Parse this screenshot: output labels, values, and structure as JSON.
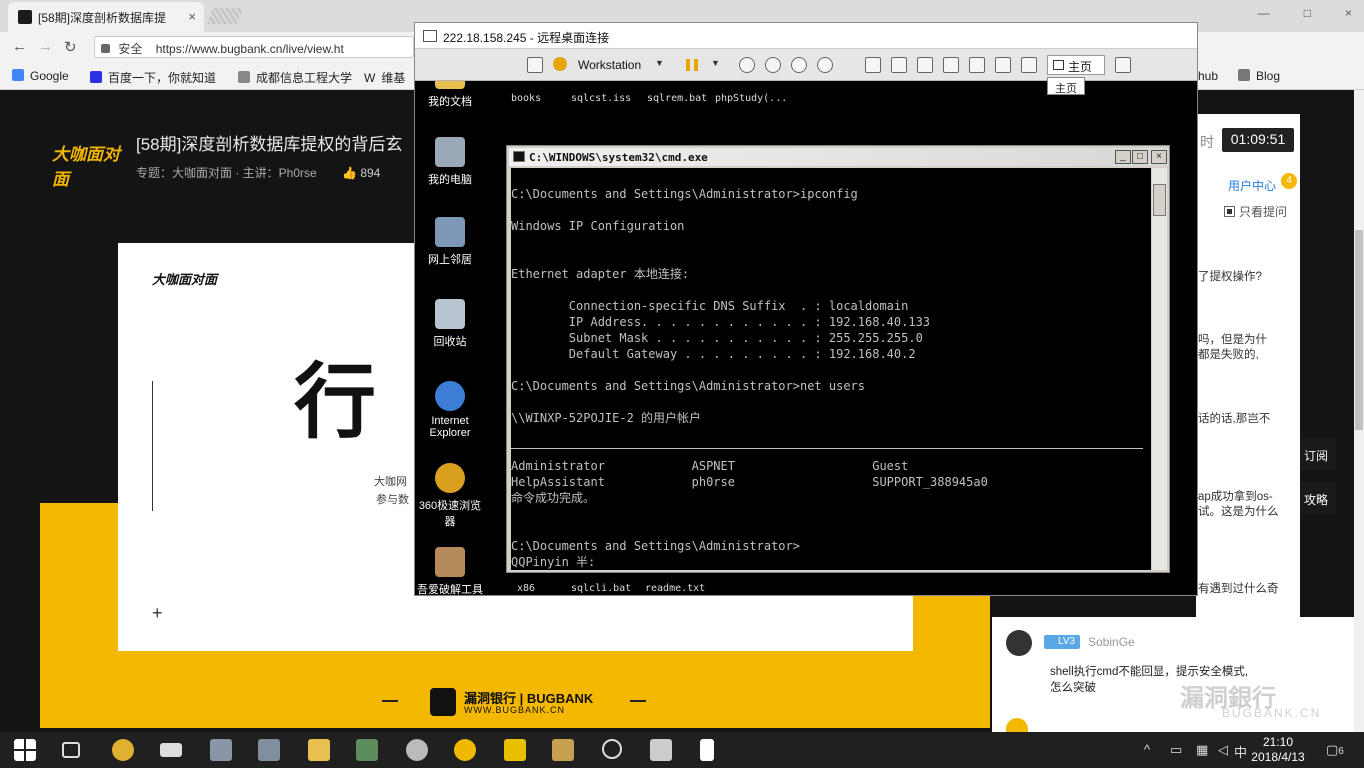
{
  "browser": {
    "tab_title": "[58期]深度剖析数据库提",
    "tab_close": "×",
    "window_controls": [
      "—",
      "□",
      "×"
    ],
    "security_label": "安全",
    "url": "https://www.bugbank.cn/live/view.ht",
    "bookmarks": [
      "Google",
      "百度一下，你就知道",
      "成都信息工程大学",
      "维基"
    ],
    "bookmark_w": "W",
    "bookmark_tail": [
      "hub",
      "Blog"
    ]
  },
  "page": {
    "course_title": "[58期]深度剖析数据库提权的背后玄",
    "course_meta": "专题：大咖面对面 · 主讲：Ph0rse",
    "likes": "894",
    "left_logo": "大咖面对面",
    "slide": {
      "logo": "大咖面对面",
      "big_char": "行",
      "sub1": "大咖网",
      "sub2": "参与数"
    },
    "footer_logo_line1": "漏洞银行 | BUGBANK",
    "footer_logo_line2": "WWW.BUGBANK.CN"
  },
  "right_panel": {
    "timer_label": "时",
    "timer": "01:09:51",
    "user_center": "用户中心",
    "user_center_badge": "4",
    "only_questions": "只看提问",
    "snippets": [
      "了提权操作?",
      "吗，但是为什",
      "都是失败的,",
      "话的话,那岂不",
      "ap成功拿到os-",
      "试。这是为什么",
      "有遇到过什么奇"
    ],
    "side_tabs": [
      "订阅",
      "攻略"
    ],
    "chat": {
      "level": "LV3",
      "user": "SobinGe",
      "msg_line1": "shell执行cmd不能回显，提示安全模式,",
      "msg_line2": "怎么突破"
    },
    "watermark": "漏洞銀行",
    "watermark_sub": "BUGBANK.CN"
  },
  "rdp": {
    "title": "222.18.158.245 - 远程桌面连接",
    "workstation": "Workstation",
    "home_label": "主页",
    "home_tooltip": "主页",
    "desktop_icons": [
      "我的文档",
      "我的电脑",
      "网上邻居",
      "回收站",
      "Internet Explorer",
      "360极速浏览器",
      "吾爱破解工具"
    ],
    "top_files": [
      "books",
      "sqlcst.iss",
      "sqlrem.bat",
      "phpStudy(..."
    ],
    "bottom_files": [
      "x86",
      "sqlcli.bat",
      "readme.txt"
    ]
  },
  "cmd": {
    "title": "C:\\WINDOWS\\system32\\cmd.exe",
    "buttons": [
      "_",
      "□",
      "×"
    ],
    "lines": [
      "C:\\Documents and Settings\\Administrator>ipconfig",
      "Windows IP Configuration",
      "Ethernet adapter 本地连接:",
      "        Connection-specific DNS Suffix  . : localdomain",
      "        IP Address. . . . . . . . . . . . : 192.168.40.133",
      "        Subnet Mask . . . . . . . . . . . : 255.255.255.0",
      "        Default Gateway . . . . . . . . . : 192.168.40.2",
      "C:\\Documents and Settings\\Administrator>net users",
      "\\\\WINXP-52POJIE-2 的用户帐户",
      "Administrator            ASPNET                   Guest",
      "HelpAssistant            ph0rse                   SUPPORT_388945a0",
      "命令成功完成。",
      "C:\\Documents and Settings\\Administrator>",
      "QQPinyin 半:"
    ]
  },
  "taskbar": {
    "time": "21:10",
    "date": "2018/4/13",
    "notification_count": "6"
  }
}
